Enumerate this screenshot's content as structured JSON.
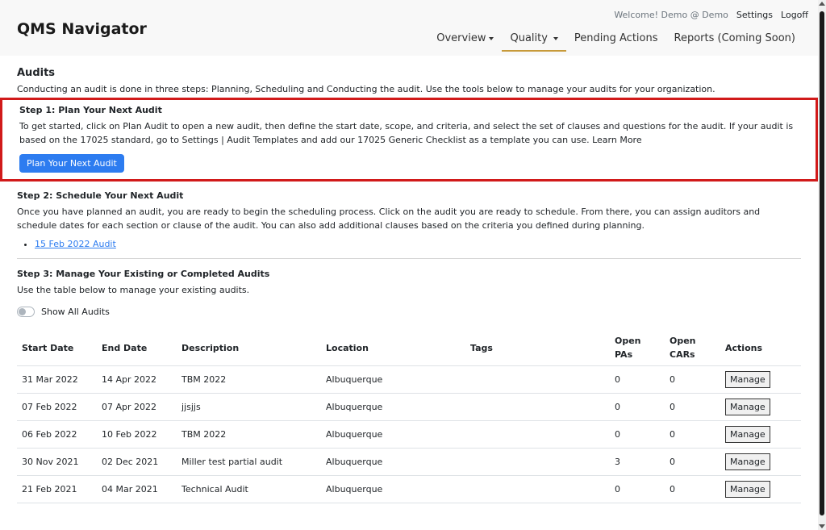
{
  "app": {
    "brand": "QMS Navigator"
  },
  "topbar": {
    "welcome": "Welcome! Demo @ Demo",
    "settings": "Settings",
    "logoff": "Logoff"
  },
  "nav": {
    "overview": "Overview",
    "quality": "Quality",
    "pending": "Pending Actions",
    "reports": "Reports (Coming Soon)"
  },
  "page": {
    "title": "Audits",
    "intro": "Conducting an audit is done in three steps: Planning, Scheduling and Conducting the audit. Use the tools below to manage your audits for your organization."
  },
  "step1": {
    "title": "Step 1: Plan Your Next Audit",
    "desc": "To get started, click on Plan Audit to open a new audit, then define the start date, scope, and criteria, and select the set of clauses and questions for the audit. If your audit is based on the 17025 standard, go to Settings | Audit Templates and add our 17025 Generic Checklist as a template you can use. Learn More",
    "button": "Plan Your Next Audit"
  },
  "step2": {
    "title": "Step 2: Schedule Your Next Audit",
    "desc": "Once you have planned an audit, you are ready to begin the scheduling process. Click on the audit you are ready to schedule. From there, you can assign auditors and schedule dates for each section or clause of the audit. You can also add additional clauses based on the criteria you defined during planning.",
    "audits": [
      "15 Feb 2022 Audit"
    ]
  },
  "step3": {
    "title": "Step 3: Manage Your Existing or Completed Audits",
    "desc": "Use the table below to manage your existing audits.",
    "toggle_label": "Show All Audits"
  },
  "table": {
    "headers": [
      "Start Date",
      "End Date",
      "Description",
      "Location",
      "Tags",
      "Open PAs",
      "Open CARs",
      "Actions"
    ],
    "rows": [
      {
        "start": "31 Mar 2022",
        "end": "14 Apr 2022",
        "desc": "TBM 2022",
        "location": "Albuquerque",
        "tags": "",
        "pas": "0",
        "cars": "0",
        "action": "Manage"
      },
      {
        "start": "07 Feb 2022",
        "end": "07 Apr 2022",
        "desc": "jjsjjs",
        "location": "Albuquerque",
        "tags": "",
        "pas": "0",
        "cars": "0",
        "action": "Manage"
      },
      {
        "start": "06 Feb 2022",
        "end": "10 Feb 2022",
        "desc": "TBM 2022",
        "location": "Albuquerque",
        "tags": "",
        "pas": "0",
        "cars": "0",
        "action": "Manage"
      },
      {
        "start": "30 Nov 2021",
        "end": "02 Dec 2021",
        "desc": "Miller test partial audit",
        "location": "Albuquerque",
        "tags": "",
        "pas": "3",
        "cars": "0",
        "action": "Manage"
      },
      {
        "start": "21 Feb 2021",
        "end": "04 Mar 2021",
        "desc": "Technical Audit",
        "location": "Albuquerque",
        "tags": "",
        "pas": "0",
        "cars": "0",
        "action": "Manage"
      }
    ]
  },
  "colors": {
    "primary": "#2d7cf0",
    "highlight": "#d11a1a",
    "nav_active": "#c79a3a"
  }
}
